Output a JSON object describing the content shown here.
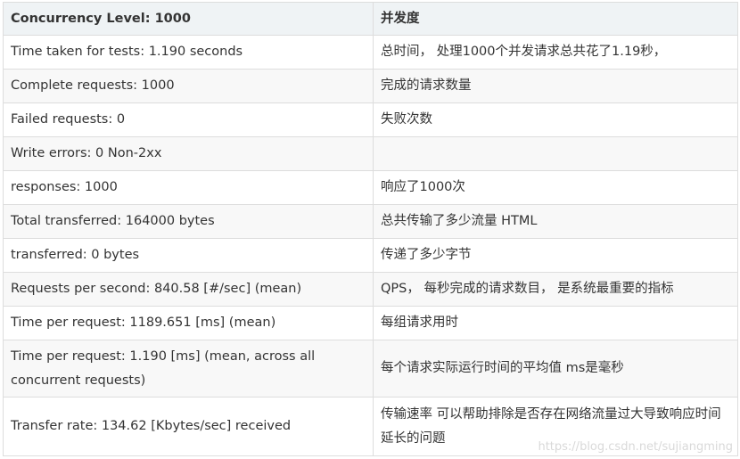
{
  "table": {
    "headers": [
      "Concurrency Level: 1000",
      "并发度"
    ],
    "rows": [
      [
        "Time taken for tests: 1.190 seconds",
        "总时间， 处理1000个并发请求总共花了1.19秒，"
      ],
      [
        "Complete requests: 1000",
        "完成的请求数量"
      ],
      [
        "Failed requests: 0",
        "失败次数"
      ],
      [
        "Write errors: 0 Non-2xx",
        ""
      ],
      [
        "responses: 1000",
        "响应了1000次"
      ],
      [
        "Total transferred: 164000 bytes",
        "总共传输了多少流量 HTML"
      ],
      [
        "transferred: 0 bytes",
        "传递了多少字节"
      ],
      [
        "Requests per second: 840.58 [#/sec] (mean)",
        "QPS， 每秒完成的请求数目， 是系统最重要的指标"
      ],
      [
        "Time per request: 1189.651 [ms] (mean)",
        "每组请求用时"
      ],
      [
        "Time per request: 1.190 [ms] (mean, across all concurrent requests)",
        "每个请求实际运行时间的平均值 ms是毫秒"
      ],
      [
        "Transfer rate: 134.62 [Kbytes/sec] received",
        "传输速率 可以帮助排除是否存在网络流量过大导致响应时间延长的问题"
      ]
    ]
  },
  "watermark": "https://blog.csdn.net/sujiangming"
}
